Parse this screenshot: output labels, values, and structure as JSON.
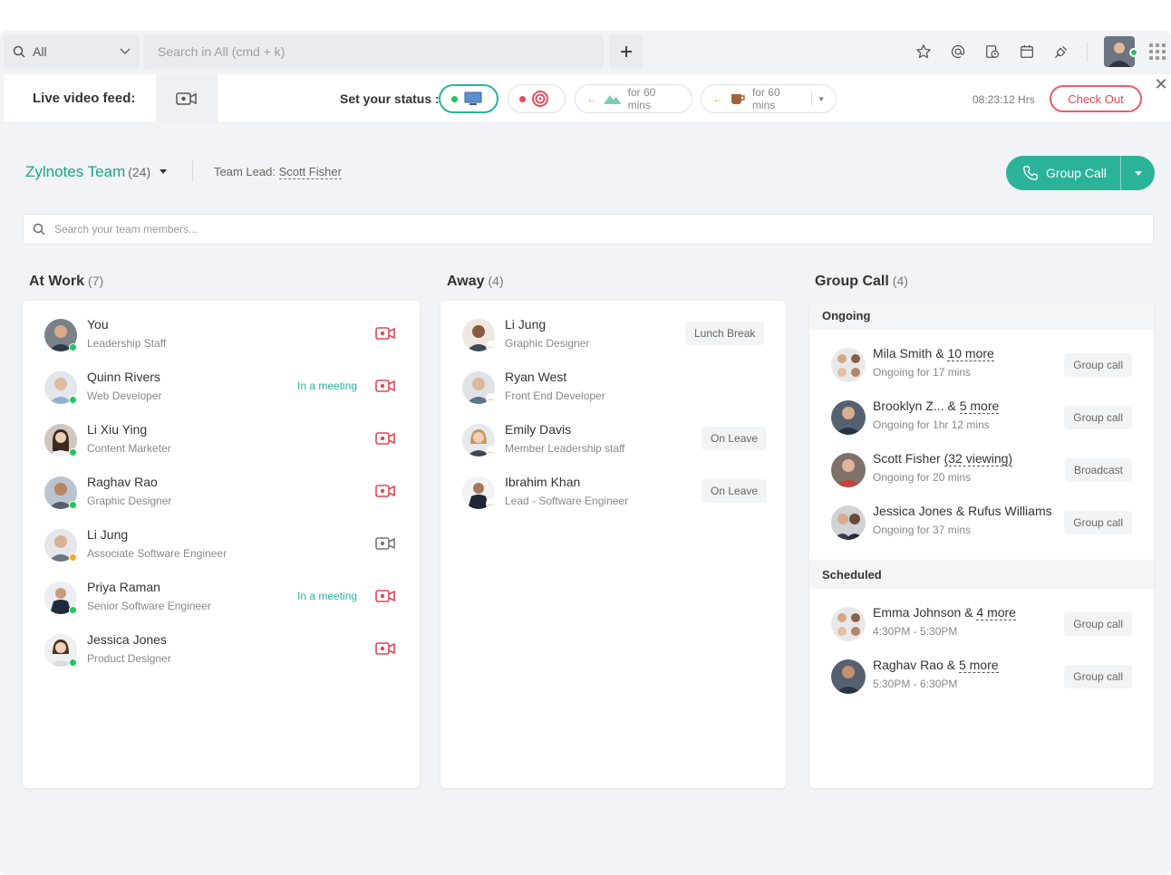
{
  "topbar": {
    "scope_label": "All",
    "search_placeholder": "Search in All (cmd + k)",
    "icons": [
      "star-icon",
      "at-icon",
      "clock-doc-icon",
      "calendar-icon",
      "plug-icon"
    ]
  },
  "status_bar": {
    "live_feed_label": "Live video feed:",
    "set_status_label": "Set your status :",
    "break_pill_1": "for 60 mins",
    "break_pill_2": "for 60 mins",
    "hours": "08:23:12 Hrs",
    "checkout_label": "Check Out"
  },
  "team": {
    "name": "Zylnotes Team",
    "count": "(24)",
    "lead_prefix": "Team Lead:",
    "lead_name": "Scott Fisher",
    "group_call_label": "Group Call",
    "search_placeholder": "Search your team members..."
  },
  "at_work": {
    "title": "At Work",
    "count": "(7)",
    "members": [
      {
        "name": "You",
        "role": "Leadership Staff",
        "status": "",
        "cam": "active"
      },
      {
        "name": "Quinn Rivers",
        "role": "Web Developer",
        "status": "In a meeting",
        "cam": "active"
      },
      {
        "name": "Li Xiu Ying",
        "role": "Content Marketer",
        "status": "",
        "cam": "active"
      },
      {
        "name": "Raghav Rao",
        "role": "Graphic Designer",
        "status": "",
        "cam": "active"
      },
      {
        "name": "Li Jung",
        "role": "Associate Software Engineer",
        "status": "",
        "cam": "inactive"
      },
      {
        "name": "Priya Raman",
        "role": "Senior Software Engineer",
        "status": "In a meeting",
        "cam": "active"
      },
      {
        "name": "Jessica Jones",
        "role": "Product Designer",
        "status": "",
        "cam": "active"
      }
    ]
  },
  "away": {
    "title": "Away",
    "count": "(4)",
    "members": [
      {
        "name": "Li Jung",
        "role": "Graphic Designer",
        "tag": "Lunch Break"
      },
      {
        "name": "Ryan West",
        "role": "Front End Developer",
        "tag": ""
      },
      {
        "name": "Emily Davis",
        "role": "Member Leadership staff",
        "tag": "On Leave"
      },
      {
        "name": "Ibrahim Khan",
        "role": "Lead - Software Engineer",
        "tag": "On Leave"
      }
    ]
  },
  "group_call": {
    "title": "Group Call",
    "count": "(4)",
    "ongoing_label": "Ongoing",
    "scheduled_label": "Scheduled",
    "ongoing": [
      {
        "title_a": "Mila Smith & ",
        "title_b": "10 more",
        "sub": "Ongoing for 17 mins",
        "tag": "Group call"
      },
      {
        "title_a": "Brooklyn Z... & ",
        "title_b": "5 more",
        "sub": "Ongoing for 1hr 12 mins",
        "tag": "Group call"
      },
      {
        "title_a": "Scott Fisher ",
        "title_b": "(32 viewing)",
        "sub": "Ongoing for 20 mins",
        "tag": "Broadcast"
      },
      {
        "title_a": "Jessica Jones & Rufus Williams",
        "title_b": "",
        "sub": "Ongoing for 37 mins",
        "tag": "Group call"
      }
    ],
    "scheduled": [
      {
        "title_a": "Emma Johnson & ",
        "title_b": "4 more",
        "sub": "4:30PM - 5:30PM",
        "tag": "Group call"
      },
      {
        "title_a": "Raghav Rao & ",
        "title_b": "5 more",
        "sub": "5:30PM - 6:30PM",
        "tag": "Group call"
      }
    ]
  },
  "colors": {
    "accent": "#2bb39a",
    "danger": "#e64553",
    "online": "#22c55e",
    "away": "#f5a623"
  }
}
